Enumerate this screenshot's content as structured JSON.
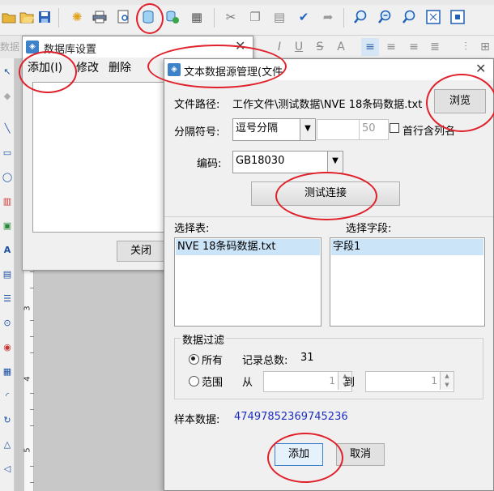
{
  "toolbar": {
    "icons": [
      "open-folder-icon",
      "save-icon",
      "settings-gear-icon",
      "print-icon",
      "print-preview-icon",
      "database-icon",
      "database-link-icon",
      "grid-icon",
      "cut-icon",
      "copy-icon",
      "paste-icon",
      "confirm-icon",
      "redo-icon",
      "zoom-in-icon",
      "zoom-out-icon",
      "zoom-icon",
      "fit-page-icon",
      "actual-size-icon"
    ]
  },
  "left_tools_label": "数据",
  "db_settings_dialog": {
    "title": "数据库设置",
    "menu": {
      "add": "添加(I)",
      "edit": "修改",
      "delete": "删除"
    },
    "close_button": "关闭"
  },
  "text_source_dialog": {
    "title": "文本数据源管理(文件",
    "file_path_label": "文件路径:",
    "file_path_value": "工作文件\\测试数据\\NVE 18条码数据.txt",
    "browse_button": "浏览",
    "separator_label": "分隔符号:",
    "separator_value": "逗号分隔",
    "separator_custom": "",
    "separator_length": "50",
    "first_row_header_label": "首行含列名",
    "encoding_label": "编码:",
    "encoding_value": "GB18030",
    "test_connection_button": "测试连接",
    "select_table_label": "选择表:",
    "select_field_label": "选择字段:",
    "tables": [
      "NVE 18条码数据.txt"
    ],
    "fields": [
      "字段1"
    ],
    "filter_group_label": "数据过滤",
    "filter_all_label": "所有",
    "record_total_label": "记录总数:",
    "record_total_value": "31",
    "filter_range_label": "范围",
    "from_label": "从",
    "from_value": "1",
    "to_label": "到",
    "to_value": "1",
    "sample_label": "样本数据:",
    "sample_value": "47497852369745236",
    "add_button": "添加",
    "cancel_button": "取消"
  },
  "ruler_numbers": [
    "3",
    "4",
    "5"
  ],
  "colors": {
    "annotation_red": "#e0202a",
    "selection_blue": "#cce4f7",
    "sample_value_blue": "#1d2fbf"
  }
}
